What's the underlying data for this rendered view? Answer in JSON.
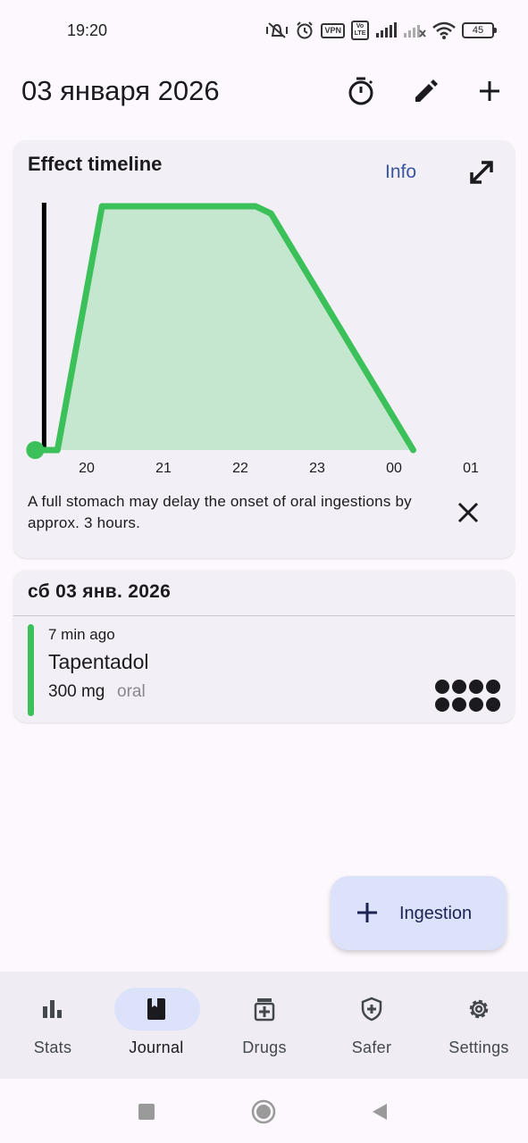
{
  "status_bar": {
    "time": "19:20",
    "vpn_label": "VPN",
    "volte_label": "Vo LTE",
    "battery": "45",
    "icons": [
      "mute-vibrate-icon",
      "alarm-icon",
      "vpn-icon",
      "volte-icon",
      "signal-icon",
      "signal-no-service-icon",
      "wifi-icon",
      "battery-icon"
    ]
  },
  "header": {
    "title": "03 января 2026",
    "actions": [
      "timer-icon",
      "edit-icon",
      "add-icon"
    ]
  },
  "timeline_card": {
    "title": "Effect timeline",
    "info_label": "Info",
    "hint": "A full stomach may delay the onset of oral ingestions by approx. 3 hours.",
    "colors": {
      "curve": "#3cc15a",
      "fill": "#c5e6cf",
      "now_line": "#000000"
    }
  },
  "chart_data": {
    "type": "area",
    "x_ticks": [
      "20",
      "21",
      "22",
      "23",
      "00",
      "01"
    ],
    "x_unit": "hour of day",
    "series": [
      {
        "x": [
          19.33,
          19.62,
          20.2,
          22.2,
          22.4,
          24.25
        ],
        "y": [
          0,
          0,
          1,
          1,
          0.97,
          0
        ]
      }
    ],
    "current_time": 19.33,
    "ylim": [
      0,
      1
    ],
    "grid": false,
    "legend": "none"
  },
  "journal": {
    "day_header": "сб 03 янв. 2026",
    "ingestions": [
      {
        "time_ago": "7 min ago",
        "name": "Tapentadol",
        "dose": "300 mg",
        "route": "oral",
        "color": "#3cc15a",
        "dots": 8
      }
    ]
  },
  "fab": {
    "label": "Ingestion",
    "icon": "add-icon"
  },
  "bottom_nav": {
    "items": [
      {
        "label": "Stats",
        "icon": "bar-chart-icon",
        "active": false
      },
      {
        "label": "Journal",
        "icon": "book-icon",
        "active": true
      },
      {
        "label": "Drugs",
        "icon": "medicine-icon",
        "active": false
      },
      {
        "label": "Safer",
        "icon": "shield-plus-icon",
        "active": false
      },
      {
        "label": "Settings",
        "icon": "gear-icon",
        "active": false
      }
    ]
  },
  "system_nav": {
    "buttons": [
      "recents-icon",
      "home-icon",
      "back-icon"
    ]
  }
}
